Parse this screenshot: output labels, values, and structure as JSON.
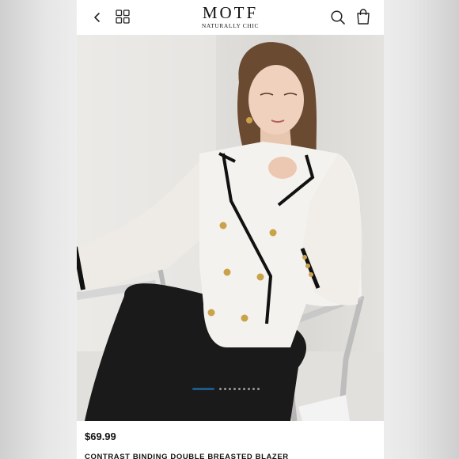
{
  "header": {
    "brand_name": "MOTF",
    "brand_tagline": "NATURALLY CHIC",
    "icons": [
      "back-icon",
      "grid-icon",
      "search-icon",
      "shopping-bag-icon"
    ]
  },
  "carousel": {
    "total_slides": 10,
    "active_slide": 1
  },
  "product": {
    "price": "$69.99",
    "name": "CONTRAST BINDING DOUBLE BREASTED BLAZER"
  },
  "colors": {
    "accent": "#1c5a8a",
    "blazer": "#f4f2ee",
    "trim": "#111111",
    "buttons": "#c9a24a"
  }
}
